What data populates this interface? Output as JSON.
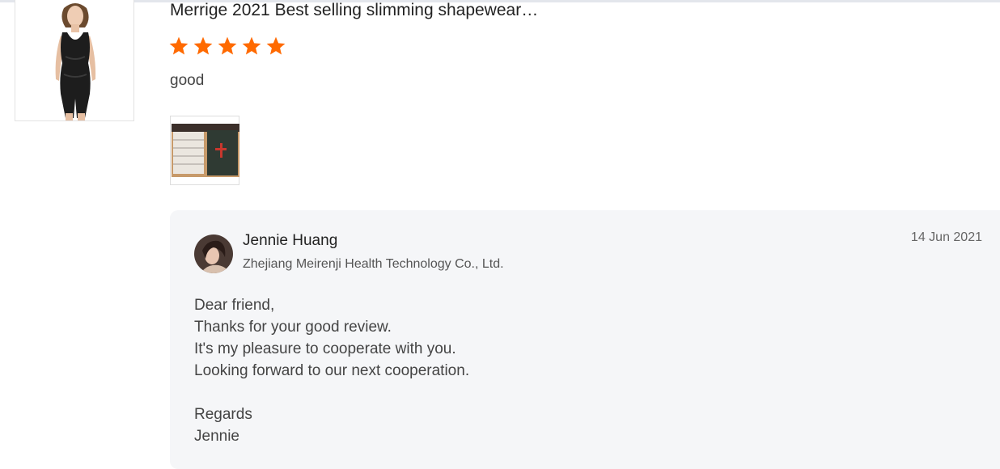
{
  "review": {
    "product_title": "Merrige 2021 Best selling slimming shapewear…",
    "rating": 5,
    "rating_max": 5,
    "star_color": "#ff6a00",
    "text": "good"
  },
  "reply": {
    "seller_name": "Jennie Huang",
    "company": "Zhejiang Meirenji Health Technology Co., Ltd.",
    "date": "14 Jun 2021",
    "lines": [
      "Dear friend,",
      "Thanks for your good review.",
      "It's my pleasure to cooperate with you.",
      "Looking forward to our next cooperation.",
      "",
      "Regards",
      "Jennie"
    ]
  },
  "icons": {
    "star": "star-icon"
  }
}
